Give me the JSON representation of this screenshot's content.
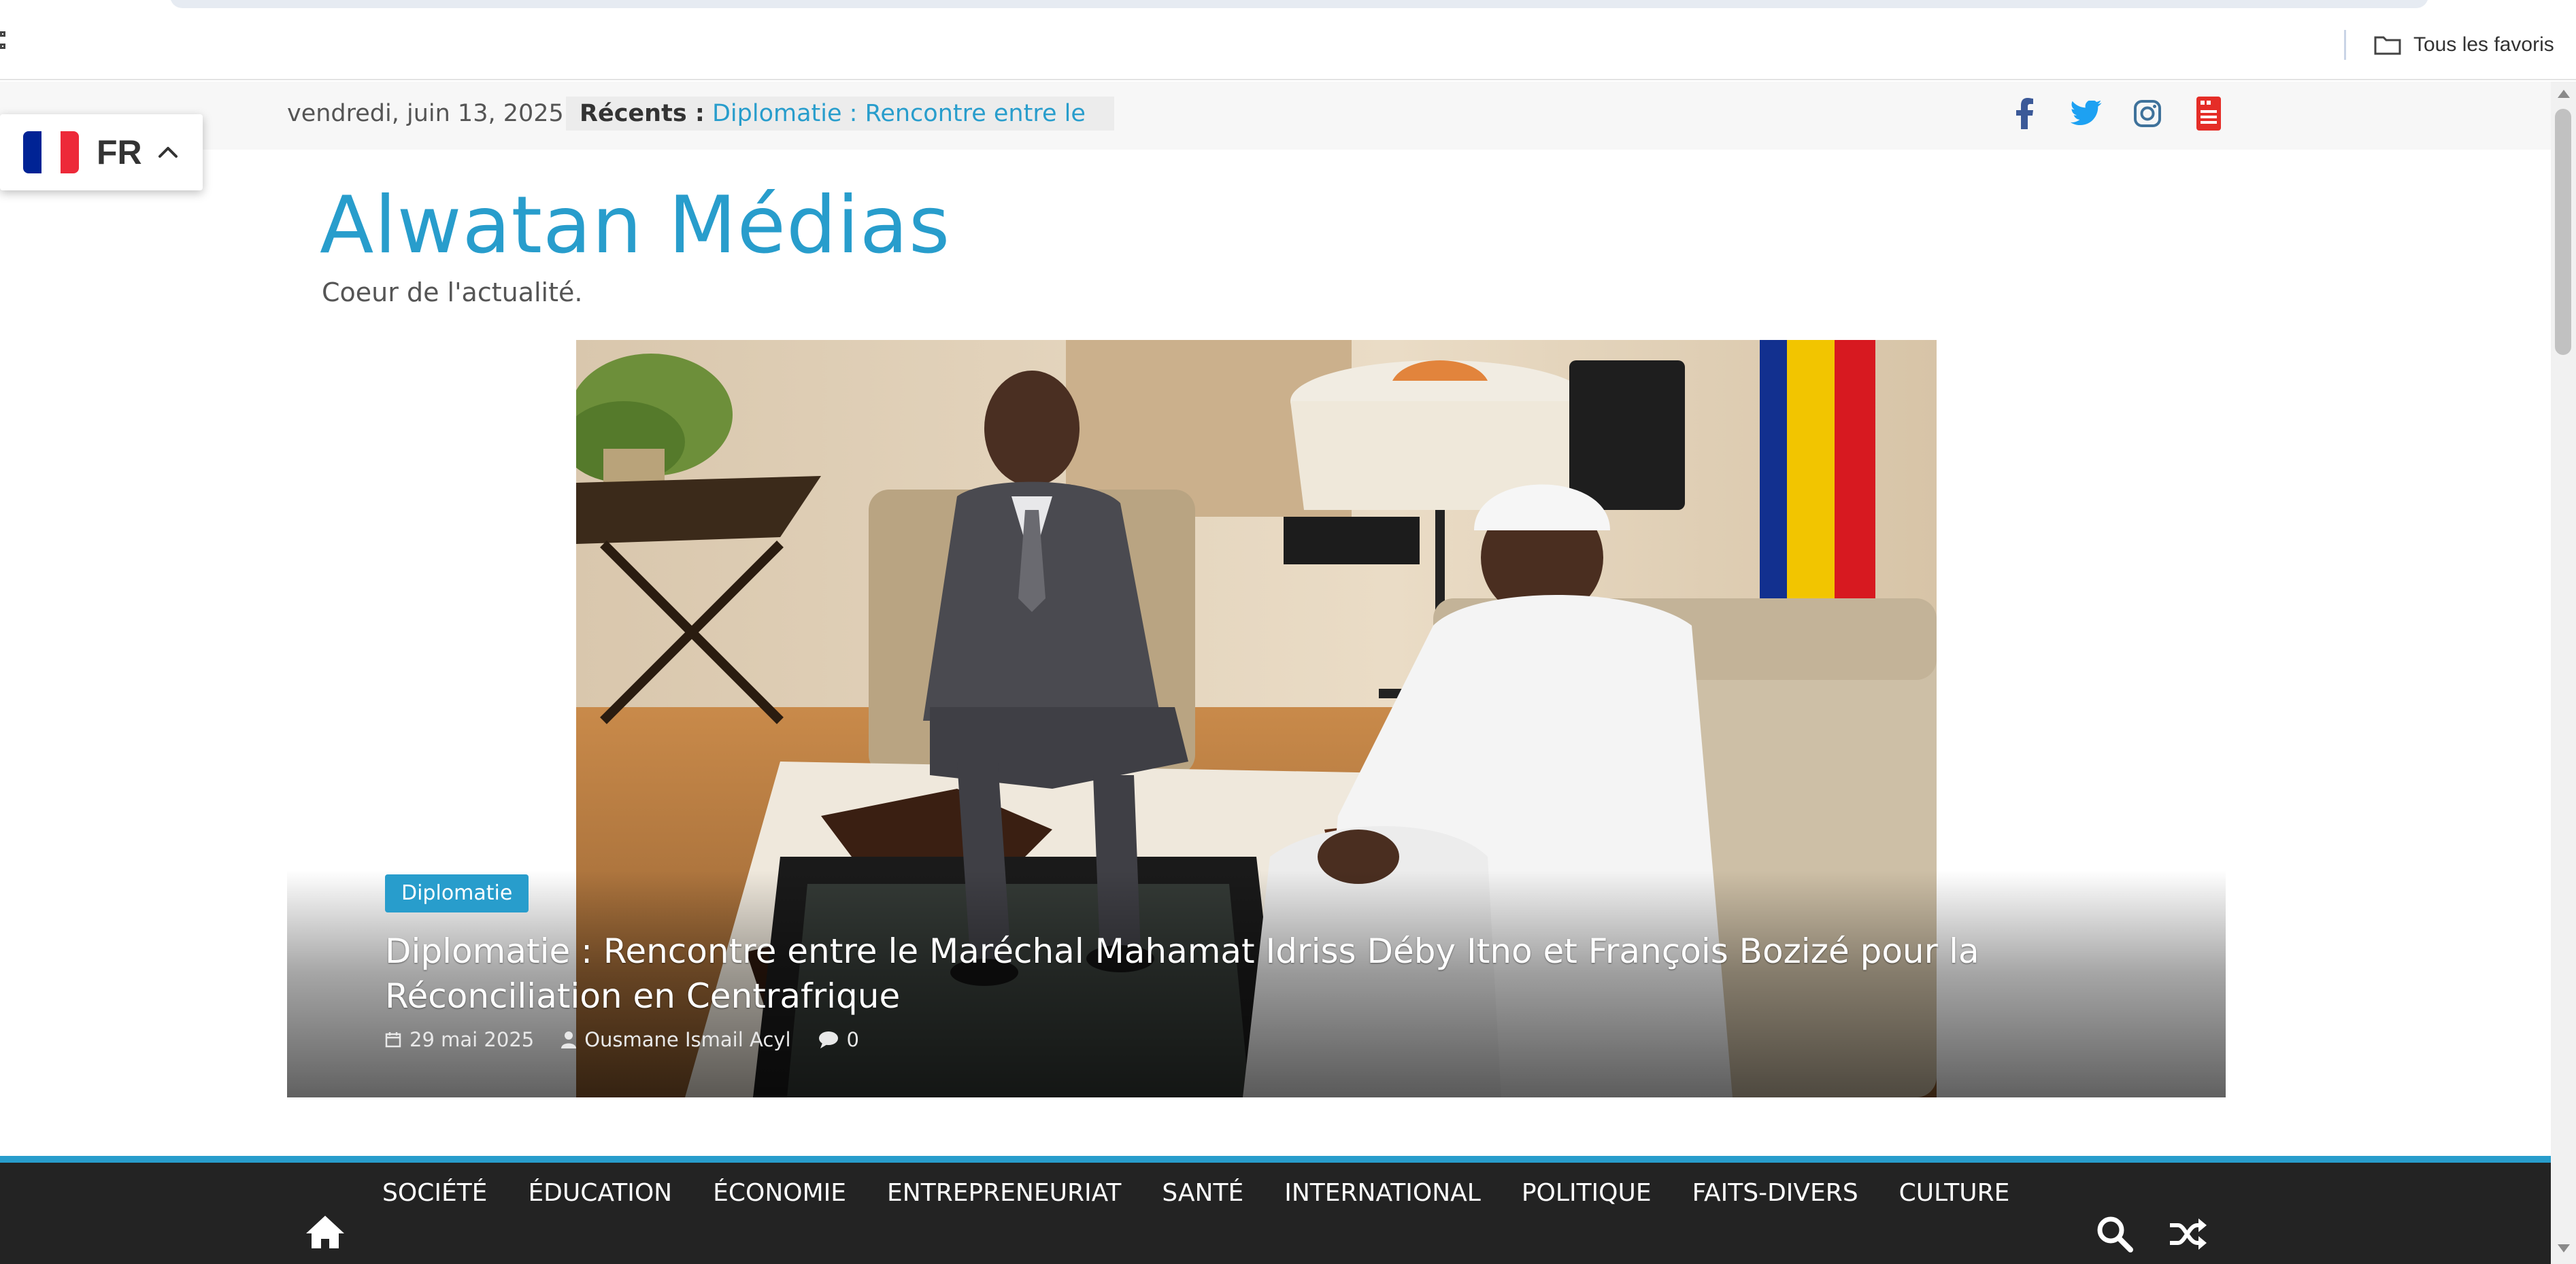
{
  "browser": {
    "all_bookmarks_label": "Tous les favoris"
  },
  "topbar": {
    "date": "vendredi, juin 13, 2025",
    "recent_label": "Récents :",
    "recent_link": "Diplomatie : Rencontre entre le",
    "social_icons": [
      "facebook-icon",
      "twitter-icon",
      "instagram-icon",
      "youtube-icon"
    ]
  },
  "language": {
    "code": "FR",
    "flag_colors": [
      "#002395",
      "#ffffff",
      "#ed2939"
    ]
  },
  "site": {
    "title": "Alwatan Médias",
    "tagline": "Coeur de l'actualité."
  },
  "hero": {
    "category": "Diplomatie",
    "title": "Diplomatie : Rencontre entre le Maréchal Mahamat Idriss Déby Itno et François Bozizé pour la Réconciliation en Centrafrique",
    "date": "29 mai 2025",
    "author": "Ousmane Ismail Acyl",
    "comments": "0"
  },
  "nav": {
    "items": [
      "SOCIÉTÉ",
      "ÉDUCATION",
      "ÉCONOMIE",
      "ENTREPRENEURIAT",
      "SANTÉ",
      "INTERNATIONAL",
      "POLITIQUE",
      "FAITS-DIVERS",
      "CULTURE"
    ]
  },
  "colors": {
    "accent": "#289dcc",
    "nav_bg": "#232323",
    "topbar_bg": "#f7f7f7"
  }
}
